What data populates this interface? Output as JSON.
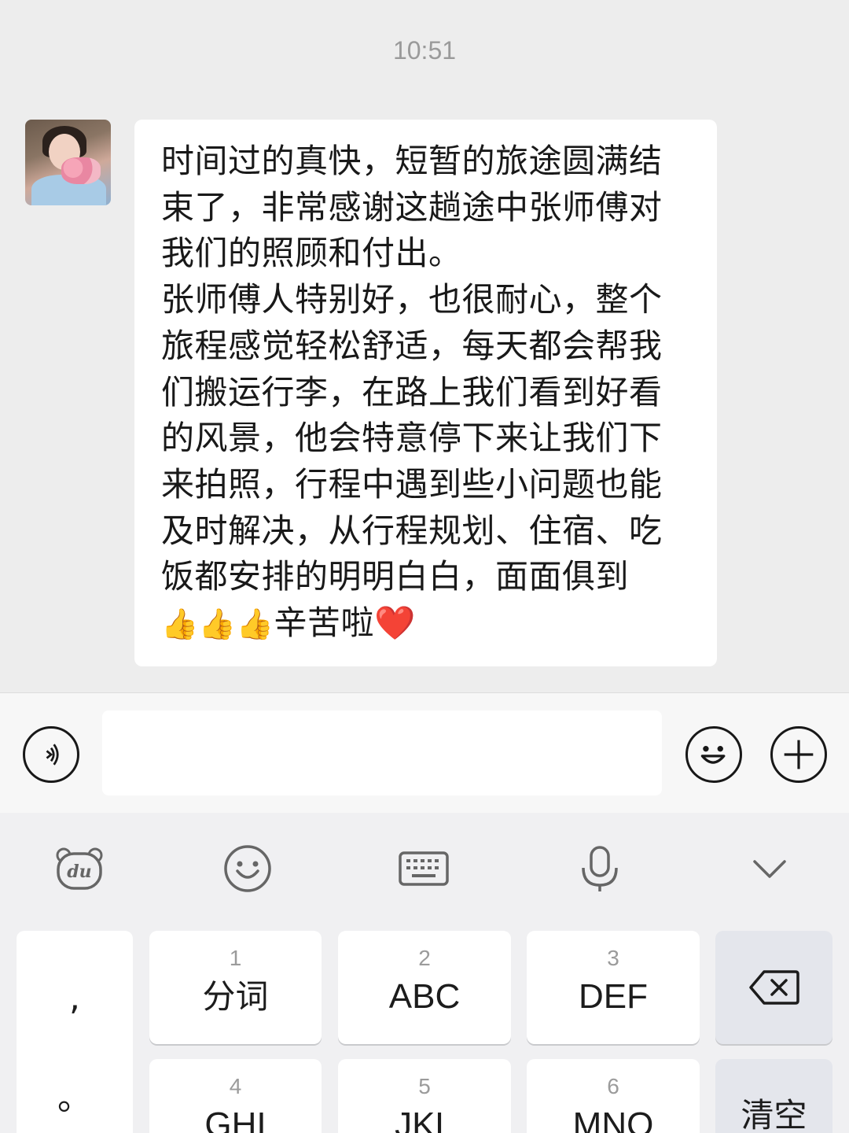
{
  "chat": {
    "timestamp": "10:51",
    "message": {
      "text": "时间过的真快，短暂的旅途圆满结束了，非常感谢这趟途中张师傅对我们的照顾和付出。\n张师傅人特别好，也很耐心，整个旅程感觉轻松舒适，每天都会帮我们搬运行李，在路上我们看到好看的风景，他会特意停下来让我们下来拍照，行程中遇到些小问题也能及时解决，从行程规划、住宿、吃饭都安排的明明白白，面面俱到",
      "emoji_tail": "👍👍👍",
      "text_tail": "辛苦啦",
      "heart": "❤️"
    }
  },
  "input_bar": {
    "voice_icon": "voice-icon",
    "emoji_icon": "smiley-icon",
    "plus_icon": "plus-icon",
    "field_value": ""
  },
  "keyboard": {
    "toolbar": [
      "du-bear-icon",
      "emoji-icon",
      "keyboard-icon",
      "microphone-icon",
      "chevron-down-icon"
    ],
    "punct": [
      ",",
      "。"
    ],
    "keys": [
      {
        "num": "1",
        "label": "分词"
      },
      {
        "num": "2",
        "label": "ABC"
      },
      {
        "num": "3",
        "label": "DEF"
      },
      {
        "num": "4",
        "label": "GHI"
      },
      {
        "num": "5",
        "label": "JKL"
      },
      {
        "num": "6",
        "label": "MNO"
      }
    ],
    "clear_label": "清空",
    "delete_icon": "backspace-icon",
    "du_text": "du"
  }
}
